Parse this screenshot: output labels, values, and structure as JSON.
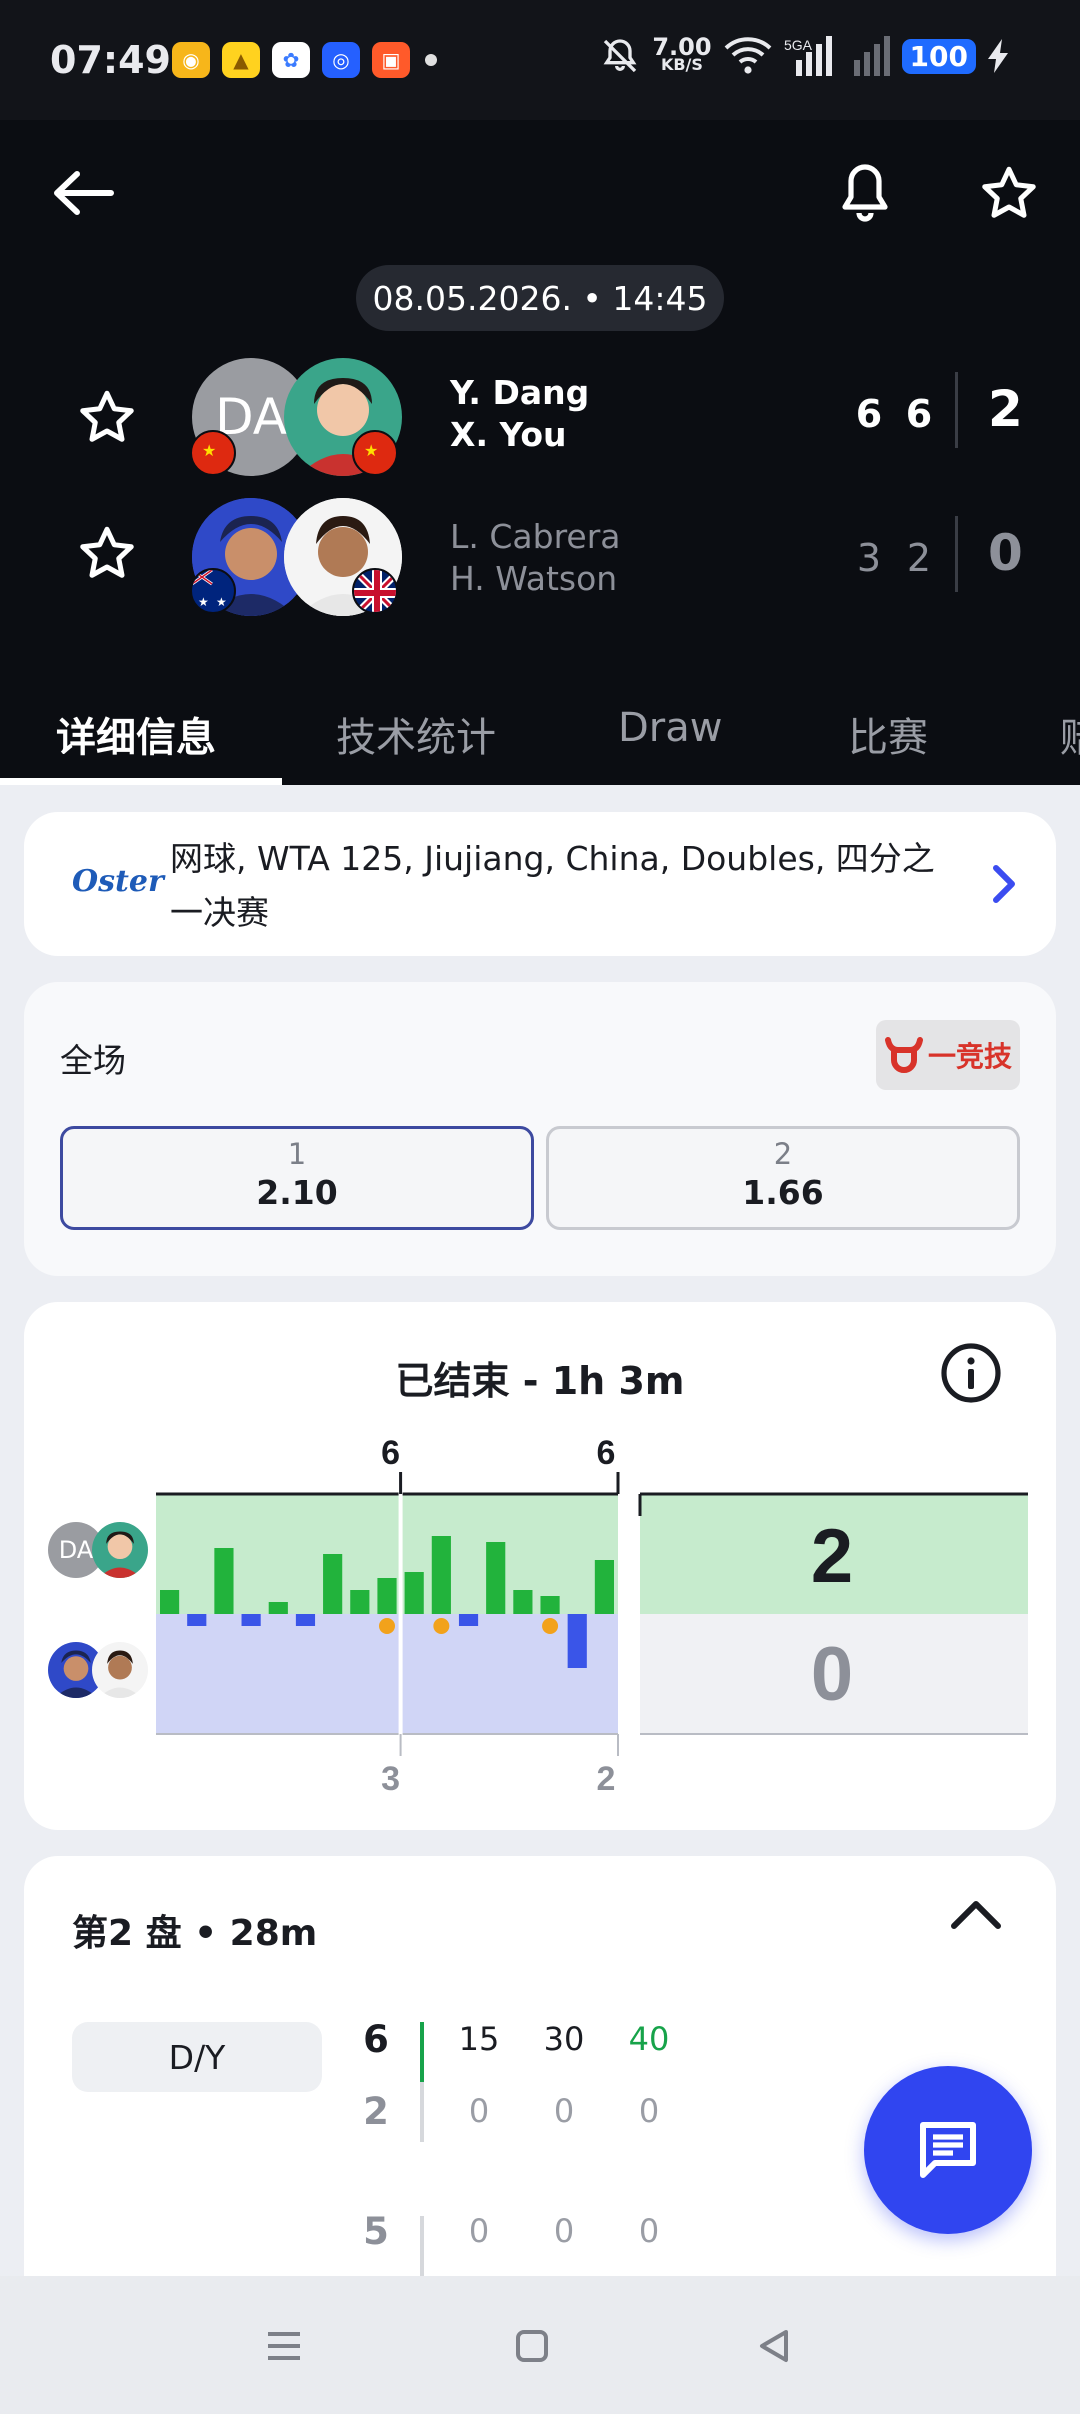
{
  "status_bar": {
    "time": "07:49",
    "net_speed_value": "7.00",
    "net_speed_unit": "KB/S",
    "signal_label": "5GA",
    "battery": "100",
    "apps": [
      "weibo-icon",
      "bell-app-icon",
      "fitness-app-icon",
      "camera-app-icon",
      "video-app-icon"
    ]
  },
  "header": {
    "back_icon": "arrow-left-icon",
    "notify_icon": "bell-icon",
    "favorite_icon": "star-icon",
    "datetime": "08.05.2026. • 14:45",
    "team1": {
      "avatar_text": "DA",
      "names": [
        "Y. Dang",
        "X. You"
      ],
      "set_scores": [
        "6",
        "6"
      ],
      "sets_won": "2",
      "flags": [
        "china",
        "china"
      ]
    },
    "team2": {
      "names": [
        "L. Cabrera",
        "H. Watson"
      ],
      "set_scores": [
        "3",
        "2"
      ],
      "sets_won": "0",
      "flags": [
        "australia",
        "uk"
      ]
    }
  },
  "tabs": [
    {
      "label": "详细信息",
      "active": true
    },
    {
      "label": "技术统计",
      "active": false
    },
    {
      "label": "Draw",
      "active": false
    },
    {
      "label": "比赛",
      "active": false
    },
    {
      "label": "赔",
      "active": false
    }
  ],
  "competition": {
    "sponsor": "Oster",
    "text": "网球, WTA 125, Jiujiang, China, Doubles, 四分之一决赛"
  },
  "odds": {
    "title": "全场",
    "provider": "一竞技",
    "options": [
      {
        "label": "1",
        "value": "2.10",
        "selected": true
      },
      {
        "label": "2",
        "value": "1.66",
        "selected": false
      }
    ]
  },
  "momentum": {
    "title": "已结束 - 1h 3m",
    "team1_avatar_text": "DA",
    "sets": [
      {
        "team1": "6",
        "team2": "3"
      },
      {
        "team1": "6",
        "team2": "2"
      }
    ],
    "total": {
      "team1": "2",
      "team2": "0"
    },
    "colors": {
      "team1": "#22b33c",
      "team2": "#3a55e8",
      "team1_bg": "#c6ebcd",
      "team2_bg": "#d0d5f6",
      "break_marker": "#f2a21b"
    }
  },
  "chart_data": {
    "type": "bar",
    "categories": [
      "S1-G1",
      "S1-G2",
      "S1-G3",
      "S1-G4",
      "S1-G5",
      "S1-G6",
      "S1-G7",
      "S1-G8",
      "S1-G9",
      "S2-G1",
      "S2-G2",
      "S2-G3",
      "S2-G4",
      "S2-G5",
      "S2-G6",
      "S2-G7",
      "S2-G8"
    ],
    "values": [
      0.2,
      -0.1,
      0.55,
      -0.1,
      0.1,
      -0.1,
      0.5,
      0.2,
      0.3,
      0.35,
      0.65,
      -0.1,
      0.6,
      0.2,
      0.15,
      -0.45,
      0.45
    ],
    "break_games": [
      8,
      10,
      14
    ],
    "ylim": [
      -1,
      1
    ],
    "set_boundaries_after": [
      9
    ]
  },
  "set_detail": {
    "title": "第2 盘 • 28m",
    "team_label": "D/Y",
    "rows": [
      {
        "games": "6",
        "points": [
          "15",
          "30",
          "40"
        ],
        "highlight": true
      },
      {
        "games": "2",
        "points": [
          "0",
          "0",
          "0"
        ],
        "highlight": false
      },
      {
        "games": "5",
        "points": [
          "0",
          "0",
          "0"
        ],
        "highlight": false
      }
    ]
  }
}
